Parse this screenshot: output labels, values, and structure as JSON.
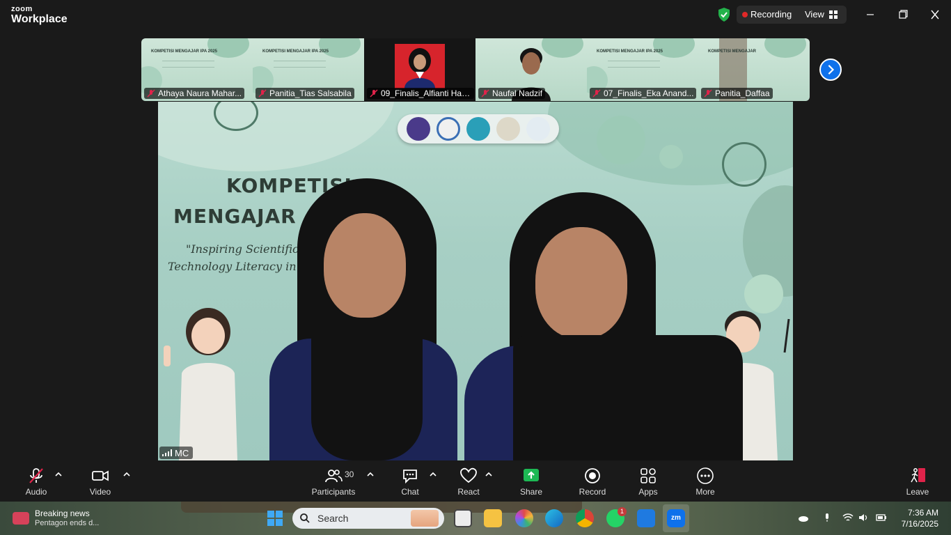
{
  "app": {
    "brand_small": "zoom",
    "brand_large": "Workplace"
  },
  "titlebar": {
    "recording_label": "Recording",
    "view_label": "View"
  },
  "thumbnails": [
    {
      "name": "Athaya Naura Mahar...",
      "kind": "slide",
      "slide_text": "KOMPETISI MENGAJAR IPA 2025"
    },
    {
      "name": "Panitia_Tias Salsabila",
      "kind": "slide",
      "slide_text": "KOMPETISI MENGAJAR IPA 2025"
    },
    {
      "name": "09_Finalis_Alfianti Has...",
      "kind": "photo"
    },
    {
      "name": "Naufal Nadzif",
      "kind": "video"
    },
    {
      "name": "07_Finalis_Eka Anand...",
      "kind": "slide",
      "slide_text": "KOMPETISI MENGAJAR IPA 2025"
    },
    {
      "name": "Panitia_Daffaa",
      "kind": "slide",
      "slide_text": "KOMPETISI MENGAJAR"
    }
  ],
  "main_video": {
    "speaker": "MC",
    "slide_title_line1": "KOMPETISI",
    "slide_title_line2": "MENGAJAR",
    "slide_subtitle_line1": "\"Inspiring Scientific C",
    "slide_subtitle_line2": "Technology Literacy in 2"
  },
  "toolbar": {
    "audio": "Audio",
    "video": "Video",
    "participants": "Participants",
    "participants_count": "30",
    "chat": "Chat",
    "react": "React",
    "share": "Share",
    "record": "Record",
    "apps": "Apps",
    "more": "More",
    "leave": "Leave"
  },
  "taskbar": {
    "news_title": "Breaking news",
    "news_subtitle": "Pentagon ends d...",
    "search_placeholder": "Search",
    "whatsapp_badge": "1",
    "time": "7:36 AM",
    "date": "7/16/2025"
  },
  "colors": {
    "accent_blue": "#0e71eb",
    "share_green": "#1db954",
    "recording_red": "#e02828",
    "leave_red": "#e0234a"
  }
}
